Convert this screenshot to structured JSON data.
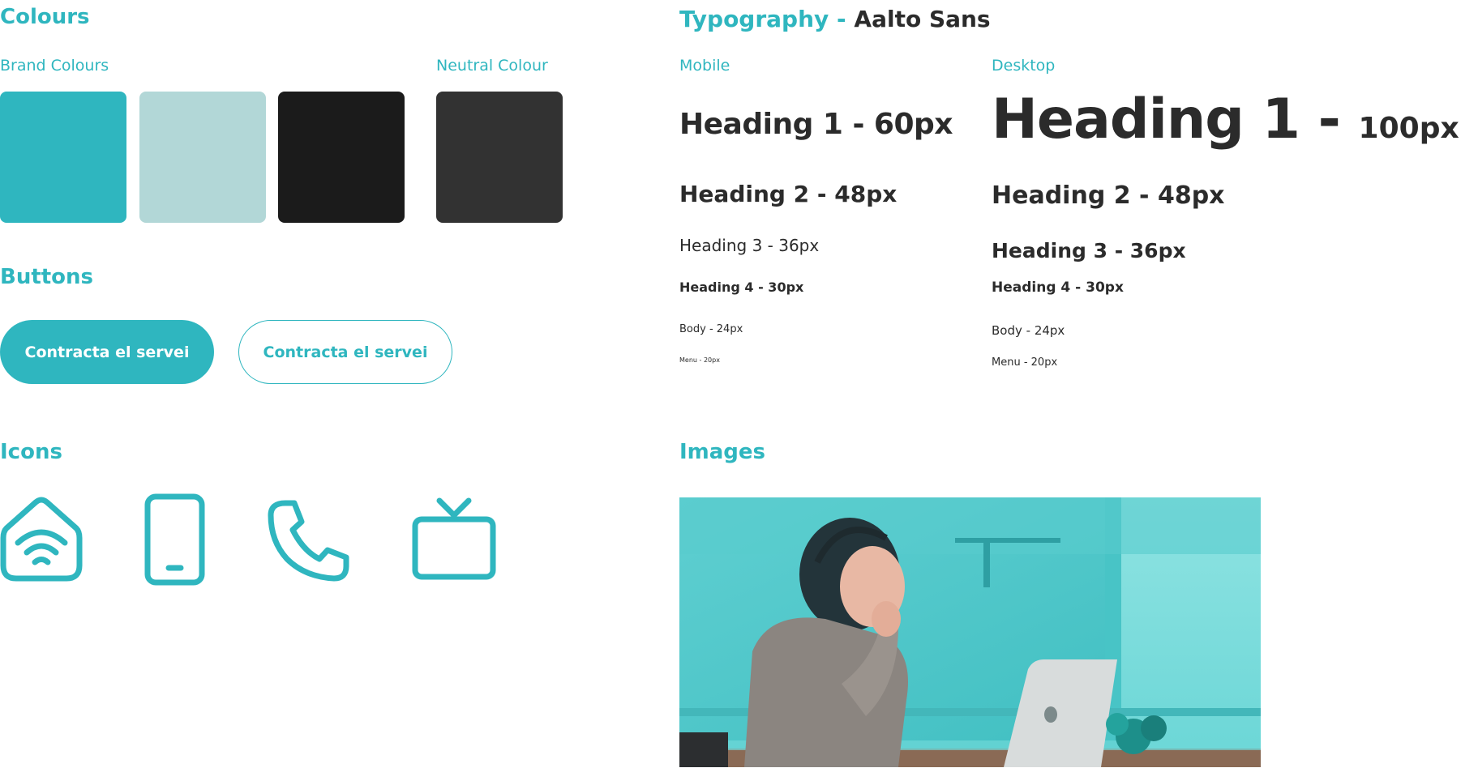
{
  "colors": {
    "accent": "#2fb6bf",
    "text_dark": "#2b2b2b",
    "brand": [
      "#2fb6bf",
      "#b2d7d7",
      "#1b1b1b"
    ],
    "neutral": "#323232"
  },
  "colours_section": {
    "title": "Colours",
    "brand_label": "Brand Colours",
    "neutral_label": "Neutral Colour"
  },
  "buttons_section": {
    "title": "Buttons",
    "primary_label": "Contracta el servei",
    "outline_label": "Contracta el servei"
  },
  "icons_section": {
    "title": "Icons",
    "icons": [
      "home-wifi-icon",
      "mobile-phone-icon",
      "telephone-icon",
      "tv-icon"
    ]
  },
  "typography_section": {
    "title_prefix": "Typography - ",
    "font_name": "Aalto Sans",
    "mobile": {
      "label": "Mobile",
      "h1": "Heading 1 - 60px",
      "h2": "Heading 2 - 48px",
      "h3": "Heading 3 - 36px",
      "h4": "Heading 4 - 30px",
      "body": "Body - 24px",
      "menu": "Menu - 20px"
    },
    "desktop": {
      "label": "Desktop",
      "h1_main": "Heading 1 - ",
      "h1_size": "100px",
      "h2": "Heading 2 - 48px",
      "h3": "Heading 3 - 36px",
      "h4": "Heading 4 - 30px",
      "body": "Body - 24px",
      "menu": "Menu - 20px"
    }
  },
  "images_section": {
    "title": "Images"
  }
}
